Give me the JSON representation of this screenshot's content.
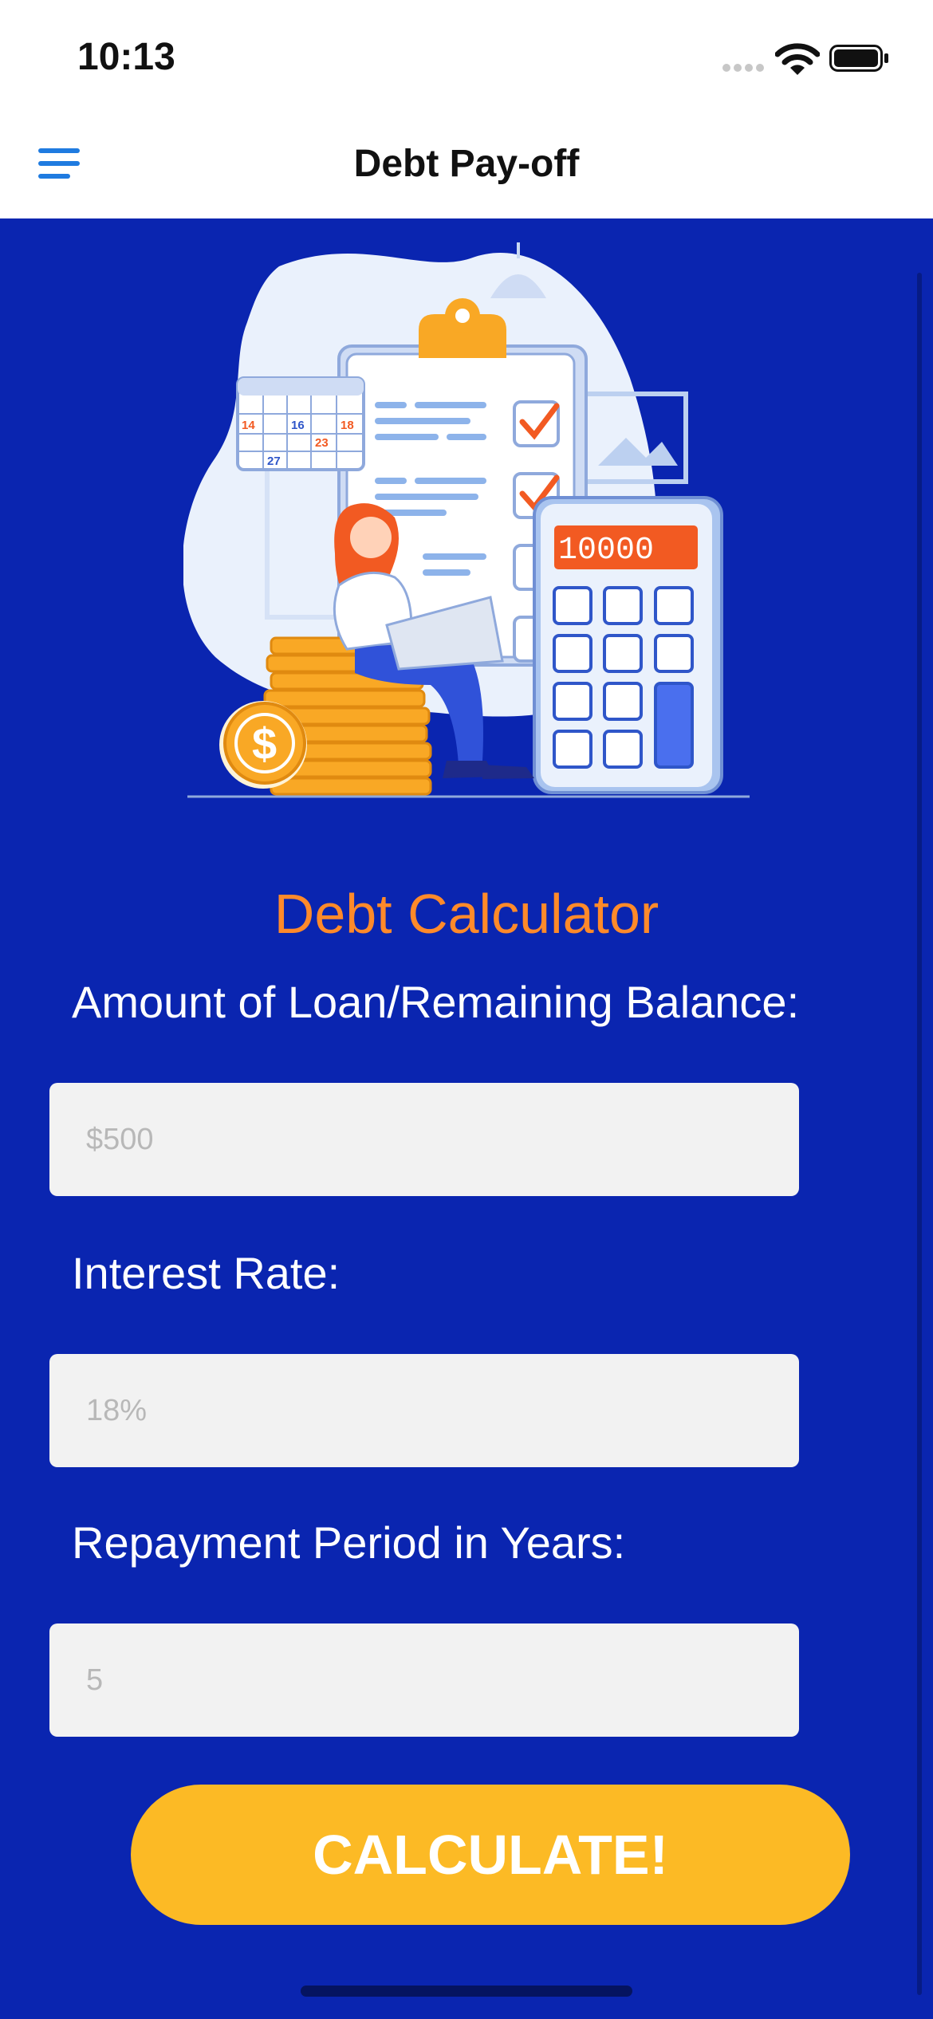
{
  "status_bar": {
    "time": "10:13"
  },
  "nav": {
    "title": "Debt Pay-off"
  },
  "hero": {
    "calendar_dates": [
      "14",
      "16",
      "18",
      "23",
      "27"
    ],
    "calculator_display": "10000"
  },
  "form": {
    "title": "Debt Calculator",
    "loan_label": "Amount of Loan/Remaining Balance:",
    "loan_placeholder": "$500",
    "rate_label": "Interest Rate:",
    "rate_placeholder": "18%",
    "period_label": "Repayment Period in Years:",
    "period_placeholder": "5",
    "submit_label": "CALCULATE!"
  },
  "colors": {
    "background": "#0a25b0",
    "accent_title": "#ff8a2a",
    "button": "#fcba25",
    "menu_icon": "#1f7be0"
  }
}
